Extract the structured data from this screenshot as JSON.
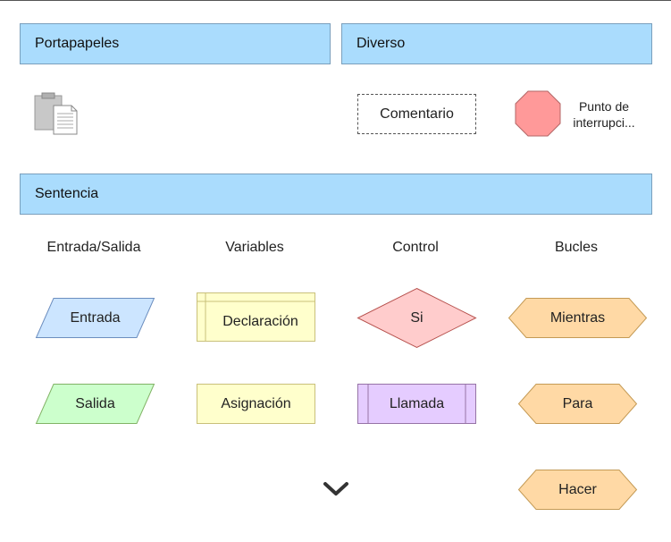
{
  "panels": {
    "clipboard": "Portapapeles",
    "misc": "Diverso",
    "statement": "Sentencia"
  },
  "misc": {
    "comment": "Comentario",
    "breakpoint": "Punto de interrupci..."
  },
  "columns": {
    "io": "Entrada/Salida",
    "variables": "Variables",
    "control": "Control",
    "loops": "Bucles"
  },
  "shapes": {
    "input": "Entrada",
    "output": "Salida",
    "declaration": "Declaración",
    "assignment": "Asignación",
    "if": "Si",
    "call": "Llamada",
    "while": "Mientras",
    "for": "Para",
    "do": "Hacer"
  },
  "icons": {
    "clipboard": "clipboard-paste-icon",
    "more": "chevron-down-icon"
  },
  "colors": {
    "panel": "#aadcfd",
    "input": "#cce5ff",
    "output": "#ccffcc",
    "variable": "#ffffcc",
    "control": "#ffcccc",
    "call": "#e5ccff",
    "loop": "#ffd9a5",
    "breakpoint": "#ff9999"
  }
}
